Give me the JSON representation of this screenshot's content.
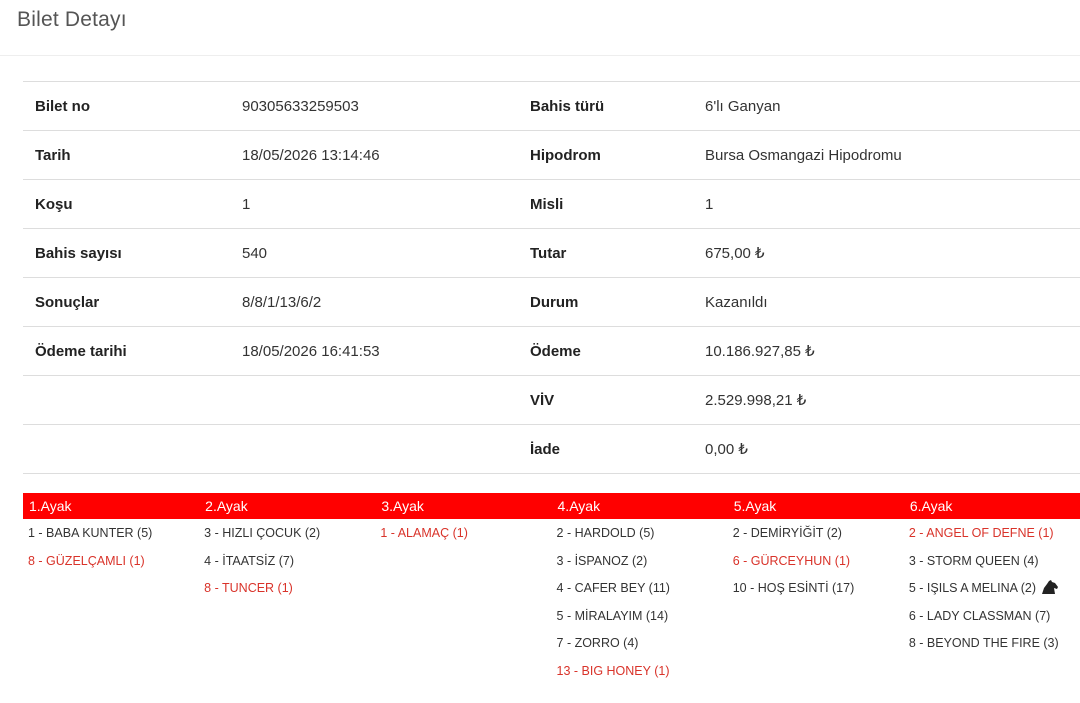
{
  "page": {
    "title": "Bilet Detayı"
  },
  "details": [
    {
      "label1": "Bilet no",
      "value1": "90305633259503",
      "label2": "Bahis türü",
      "value2": "6'lı Ganyan"
    },
    {
      "label1": "Tarih",
      "value1": "18/05/2026 13:14:46",
      "label2": "Hipodrom",
      "value2": "Bursa Osmangazi Hipodromu"
    },
    {
      "label1": "Koşu",
      "value1": "1",
      "label2": "Misli",
      "value2": "1"
    },
    {
      "label1": "Bahis sayısı",
      "value1": "540",
      "label2": "Tutar",
      "value2": "675,00 ₺"
    },
    {
      "label1": "Sonuçlar",
      "value1": "8/8/1/13/6/2",
      "label2": "Durum",
      "value2": "Kazanıldı"
    },
    {
      "label1": "Ödeme tarihi",
      "value1": "18/05/2026 16:41:53",
      "label2": "Ödeme",
      "value2": "10.186.927,85 ₺"
    },
    {
      "label1": "",
      "value1": "",
      "label2": "VİV",
      "value2": "2.529.998,21 ₺"
    },
    {
      "label1": "",
      "value1": "",
      "label2": "İade",
      "value2": "0,00 ₺"
    }
  ],
  "legs": [
    {
      "title": "1.Ayak",
      "items": [
        {
          "text": "1 - BABA KUNTER (5)",
          "winner": false
        },
        {
          "text": "8 - GÜZELÇAMLI (1)",
          "winner": true
        }
      ]
    },
    {
      "title": "2.Ayak",
      "items": [
        {
          "text": "3 - HIZLI ÇOCUK (2)",
          "winner": false
        },
        {
          "text": "4 - İTAATSİZ (7)",
          "winner": false
        },
        {
          "text": "8 - TUNCER (1)",
          "winner": true
        }
      ]
    },
    {
      "title": "3.Ayak",
      "items": [
        {
          "text": "1 - ALAMAÇ (1)",
          "winner": true
        }
      ]
    },
    {
      "title": "4.Ayak",
      "items": [
        {
          "text": "2 - HARDOLD (5)",
          "winner": false
        },
        {
          "text": "3 - İSPANOZ (2)",
          "winner": false
        },
        {
          "text": "4 - CAFER BEY (11)",
          "winner": false
        },
        {
          "text": "5 - MİRALAYIM (14)",
          "winner": false
        },
        {
          "text": "7 - ZORRO (4)",
          "winner": false
        },
        {
          "text": "13 - BIG HONEY (1)",
          "winner": true
        }
      ]
    },
    {
      "title": "5.Ayak",
      "items": [
        {
          "text": "2 - DEMİRYİĞİT (2)",
          "winner": false
        },
        {
          "text": "6 - GÜRCEYHUN (1)",
          "winner": true
        },
        {
          "text": "10 - HOŞ ESİNTİ (17)",
          "winner": false
        }
      ]
    },
    {
      "title": "6.Ayak",
      "items": [
        {
          "text": "2 - ANGEL OF DEFNE (1)",
          "winner": true
        },
        {
          "text": "3 - STORM QUEEN (4)",
          "winner": false
        },
        {
          "text": "5 - IŞILS A MELINA (2)",
          "winner": false,
          "icon": "horse-head-icon"
        },
        {
          "text": "6 - LADY CLASSMAN (7)",
          "winner": false
        },
        {
          "text": "8 - BEYOND THE FIRE (3)",
          "winner": false
        }
      ]
    }
  ],
  "colors": {
    "leg_header_bg": "#ff0000",
    "winner_text": "#d9332a"
  }
}
